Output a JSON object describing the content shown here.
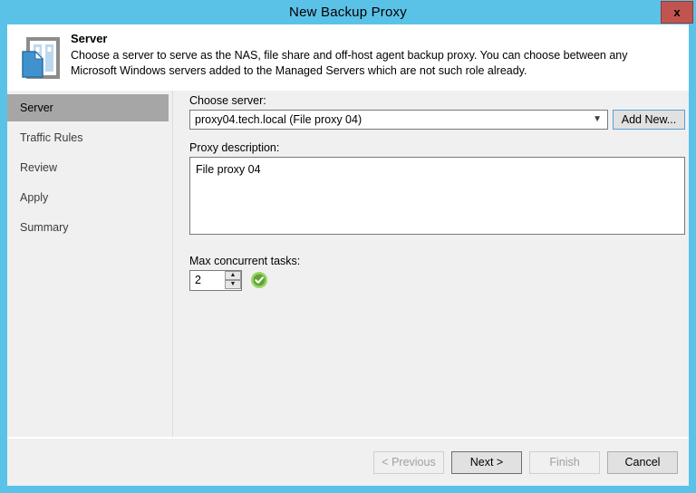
{
  "window": {
    "title": "New Backup Proxy",
    "close_label": "x",
    "accent_color": "#5bc2e7",
    "close_color": "#c25450"
  },
  "header": {
    "icon": "server-proxy-icon",
    "title": "Server",
    "description": "Choose a server to serve as the NAS, file share and off-host agent backup proxy. You can choose between any Microsoft Windows servers added to the Managed Servers which are not such role already."
  },
  "sidebar": {
    "items": [
      {
        "label": "Server",
        "selected": true
      },
      {
        "label": "Traffic Rules",
        "selected": false
      },
      {
        "label": "Review",
        "selected": false
      },
      {
        "label": "Apply",
        "selected": false
      },
      {
        "label": "Summary",
        "selected": false
      }
    ],
    "selected_color": "#a6a6a6"
  },
  "main": {
    "choose_server": {
      "label": "Choose server:",
      "value": "proxy04.tech.local (File proxy 04)",
      "dropdown_icon": "chevron-down-icon",
      "add_new_label": "Add New..."
    },
    "proxy_description": {
      "label": "Proxy description:",
      "value": "File proxy 04"
    },
    "max_concurrent_tasks": {
      "label": "Max concurrent tasks:",
      "value": "2",
      "up_icon": "chevron-up-icon",
      "down_icon": "chevron-down-icon",
      "status_icon": "success-check-icon",
      "status_color": "#70bf44"
    }
  },
  "footer": {
    "buttons": [
      {
        "label": "< Previous",
        "state": "disabled"
      },
      {
        "label": "Next >",
        "state": "default"
      },
      {
        "label": "Finish",
        "state": "disabled"
      },
      {
        "label": "Cancel",
        "state": "enabled"
      }
    ]
  }
}
